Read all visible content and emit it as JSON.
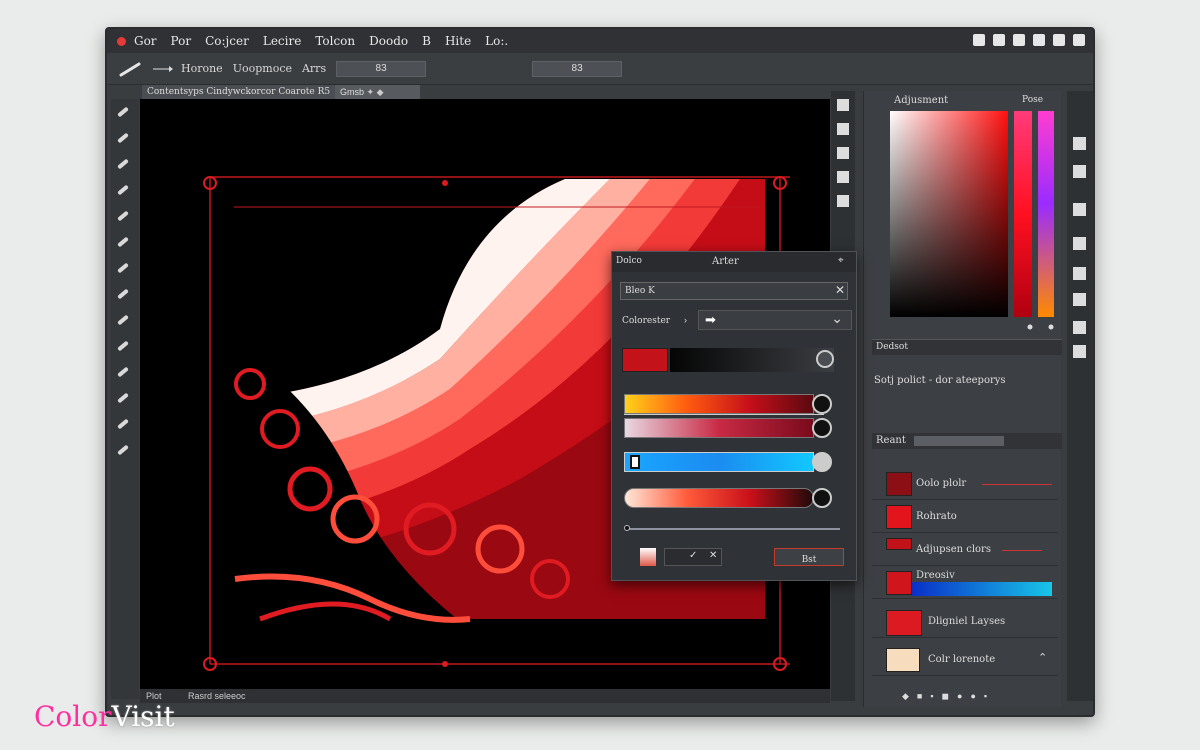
{
  "menu": {
    "items": [
      "Gor",
      "Por",
      "Co:jcer",
      "Lecire",
      "Tolcon",
      "Doodo",
      "B",
      "Hite",
      "Lo:."
    ]
  },
  "options_bar": {
    "labels": [
      "Horone",
      "Uoopmoce",
      "Arrs"
    ],
    "field1": "83",
    "field2": "83"
  },
  "document": {
    "tab_title": "Contentsyps Cindywckorcor Coarote",
    "tab_suffix": "R5",
    "tab2": "Gmsb",
    "status_left": "Plot",
    "status_right": "Rasrd seleeoc"
  },
  "adjustment_panel": {
    "title": "Adjusment",
    "mode": "Pose"
  },
  "detail": {
    "label": "Dedsot",
    "swatch_label": "Sotj polict - dor ateeporys"
  },
  "layers": {
    "header": "Reant",
    "items": [
      {
        "name": "Oolo plolr",
        "color": "#8b0f14"
      },
      {
        "name": "Rohrato",
        "color": "#e3141c"
      },
      {
        "name": "Adjupsen clors",
        "color": "#c1121a"
      },
      {
        "name": "Dreosiv",
        "color": "#d1151c"
      },
      {
        "name": "Dligniel Layses",
        "color": "#dc1a22"
      },
      {
        "name": "Colr lorenote",
        "color": "#f7dcbd"
      }
    ]
  },
  "dialog": {
    "title_left": "Dolco",
    "title_right": "Arter",
    "search_value": "Bleo K",
    "select_label": "Colorester",
    "button_label": "Bst"
  },
  "watermark": {
    "brand_part1": "Color",
    "brand_part2": "Visit"
  }
}
